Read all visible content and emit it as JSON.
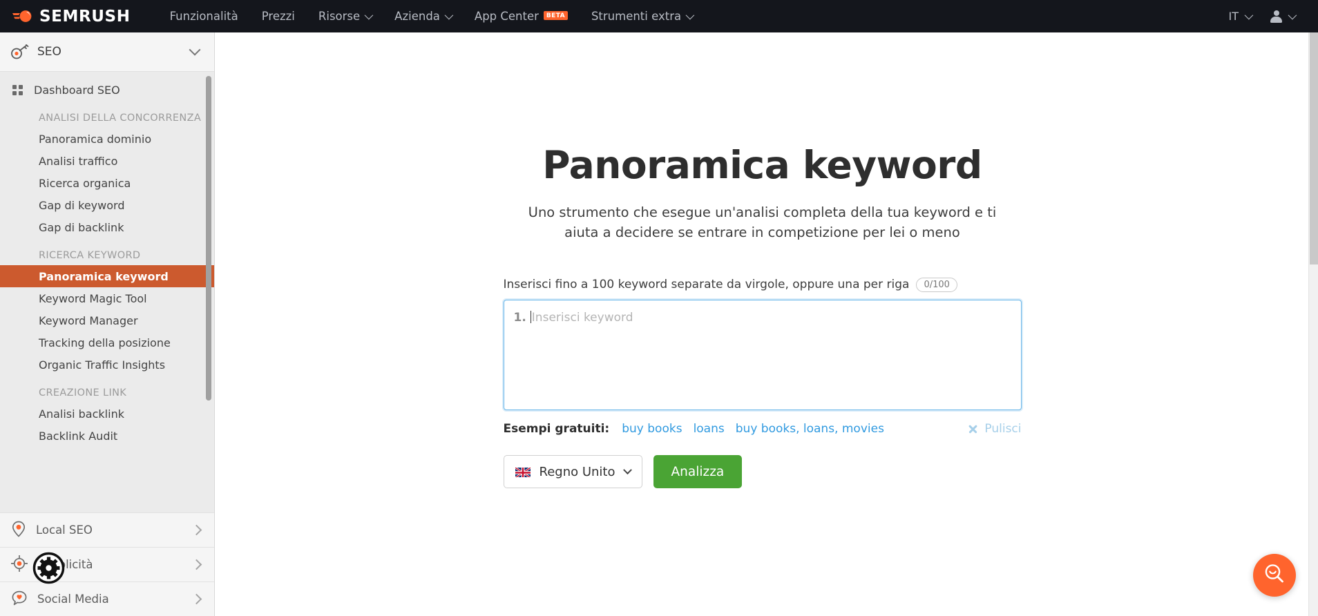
{
  "topbar": {
    "logo_text": "SEMRUSH",
    "logo_icon": "semrush-comet-icon",
    "nav": [
      {
        "label": "Funzionalità",
        "has_chevron": false,
        "badge": null
      },
      {
        "label": "Prezzi",
        "has_chevron": false,
        "badge": null
      },
      {
        "label": "Risorse",
        "has_chevron": true,
        "badge": null
      },
      {
        "label": "Azienda",
        "has_chevron": true,
        "badge": null
      },
      {
        "label": "App Center",
        "has_chevron": false,
        "badge": "BETA"
      },
      {
        "label": "Strumenti extra",
        "has_chevron": true,
        "badge": null
      }
    ],
    "language": "IT",
    "account_icon": "user-avatar-icon",
    "background": "#14161c"
  },
  "sidebar": {
    "header": {
      "label": "SEO",
      "icon": "key-icon",
      "chevron": "chevron-down-icon"
    },
    "nav": [
      {
        "type": "item",
        "label": "Dashboard SEO",
        "icon": "grid-icon",
        "active": false
      },
      {
        "type": "group",
        "label": "ANALISI DELLA CONCORRENZA"
      },
      {
        "type": "item",
        "label": "Panoramica dominio",
        "active": false
      },
      {
        "type": "item",
        "label": "Analisi traffico",
        "active": false
      },
      {
        "type": "item",
        "label": "Ricerca organica",
        "active": false
      },
      {
        "type": "item",
        "label": "Gap di keyword",
        "active": false
      },
      {
        "type": "item",
        "label": "Gap di backlink",
        "active": false
      },
      {
        "type": "group",
        "label": "RICERCA KEYWORD"
      },
      {
        "type": "item",
        "label": "Panoramica keyword",
        "active": true
      },
      {
        "type": "item",
        "label": "Keyword Magic Tool",
        "active": false
      },
      {
        "type": "item",
        "label": "Keyword Manager",
        "active": false
      },
      {
        "type": "item",
        "label": "Tracking della posizione",
        "active": false
      },
      {
        "type": "item",
        "label": "Organic Traffic Insights",
        "active": false
      },
      {
        "type": "group",
        "label": "CREAZIONE LINK"
      },
      {
        "type": "item",
        "label": "Analisi backlink",
        "active": false
      },
      {
        "type": "item",
        "label": "Backlink Audit",
        "active": false
      }
    ],
    "footer": [
      {
        "label": "Local SEO",
        "icon": "map-pin-icon"
      },
      {
        "label": "Pubblicità",
        "icon": "target-icon"
      },
      {
        "label": "Social Media",
        "icon": "chat-heart-icon"
      }
    ],
    "active_color": "#cc5a2e",
    "background": "#ebebeb"
  },
  "main": {
    "title": "Panoramica keyword",
    "subtitle": "Uno strumento che esegue un'analisi completa della tua keyword e ti aiuta a decidere se entrare in competizione per lei o meno",
    "form": {
      "instruction": "Inserisci fino a 100 keyword separate da virgole, oppure una per riga",
      "counter": "0/100",
      "line_number": "1.",
      "textarea_placeholder": "Inserisci keyword",
      "textarea_value": "",
      "examples_label": "Esempi gratuiti:",
      "examples": [
        "buy books",
        "loans",
        "buy books, loans, movies"
      ],
      "clear_label": "Pulisci",
      "clear_icon": "close-x-icon",
      "country_value": "Regno Unito",
      "country_flag": "uk-flag-icon",
      "country_chevron": "chevron-down-icon",
      "analyze_label": "Analizza",
      "analyze_color": "#4aa434",
      "link_color": "#309ae0",
      "focus_border_color": "#67b5e8"
    }
  },
  "fab": {
    "icon": "search-smile-icon",
    "color": "#ff642d"
  },
  "cursor": {
    "icon": "gear-cursor-icon"
  }
}
